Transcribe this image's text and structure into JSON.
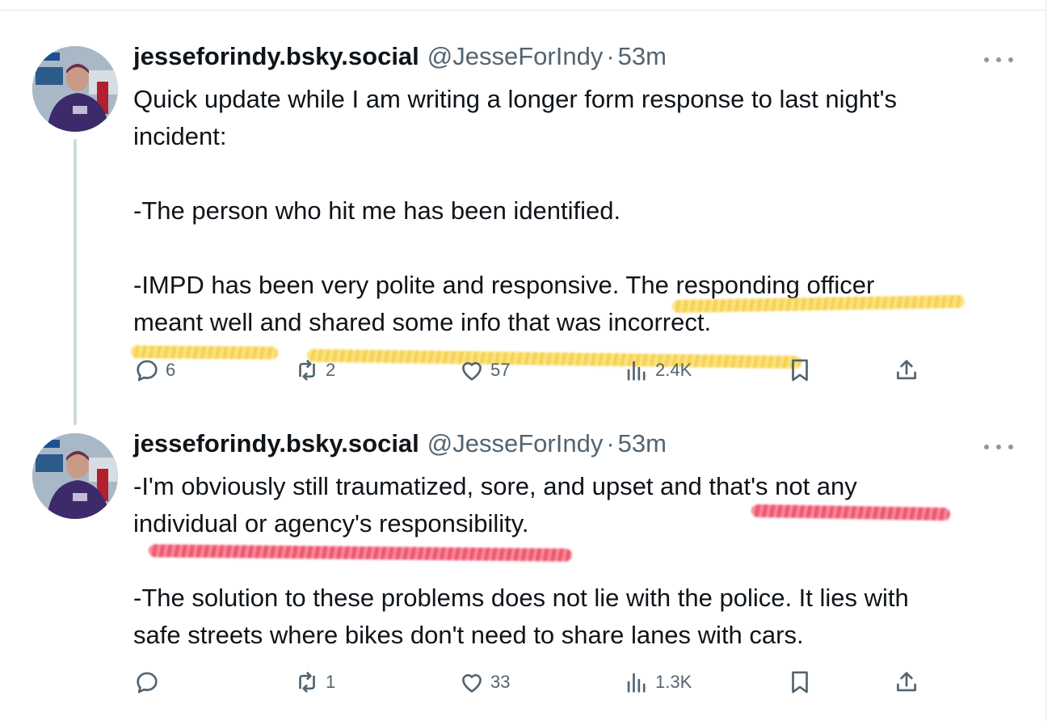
{
  "tweets": [
    {
      "display_name": "jesseforindy.bsky.social",
      "handle": "@JesseForIndy",
      "separator": "·",
      "time": "53m",
      "text": "Quick update while I am writing a longer form response to last night's\nincident:\n\n-The person who hit me has been identified.\n\n-IMPD has been very polite and responsive. The responding officer\nmeant well and shared some info that was incorrect.",
      "replies": "6",
      "reposts": "2",
      "likes": "57",
      "views": "2.4K"
    },
    {
      "display_name": "jesseforindy.bsky.social",
      "handle": "@JesseForIndy",
      "separator": "·",
      "time": "53m",
      "text": "-I'm obviously still traumatized, sore, and upset and that's not any\nindividual or agency's responsibility.\n\n-The solution to these problems does not lie with the police. It lies with\nsafe streets where bikes don't need to share lanes with cars.",
      "replies": "",
      "reposts": "1",
      "likes": "33",
      "views": "1.3K"
    }
  ],
  "annotation_colors": {
    "yellow": "#f8d24a",
    "red": "#f0465f"
  },
  "icons": [
    "more-icon",
    "reply-icon",
    "repost-icon",
    "like-icon",
    "views-icon",
    "bookmark-icon",
    "share-icon"
  ]
}
